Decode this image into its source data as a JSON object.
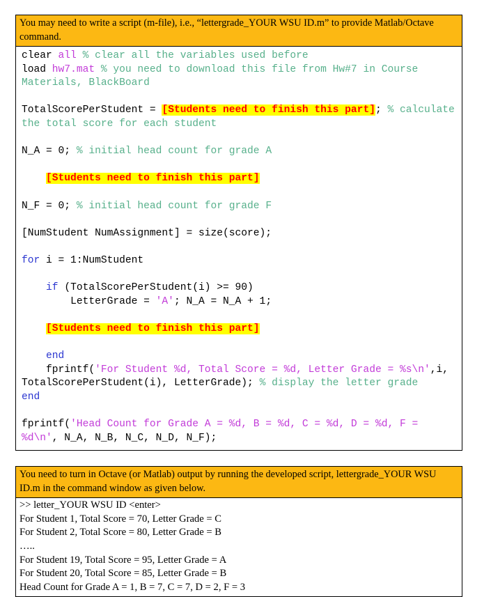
{
  "script_section": {
    "instruction": "You may need to write a script (m-file), i.e., “lettergrade_YOUR WSU ID.m” to provide Matlab/Octave command.",
    "code_lines": [
      [
        {
          "t": "clear ",
          "c": "plain"
        },
        {
          "t": "all ",
          "c": "str"
        },
        {
          "t": "% clear all the variables used before",
          "c": "cmt"
        }
      ],
      [
        {
          "t": "load ",
          "c": "plain"
        },
        {
          "t": "hw7.mat ",
          "c": "str"
        },
        {
          "t": "% you need to download this file from Hw#7 in Course Materials, BlackBoard",
          "c": "cmt"
        }
      ],
      [],
      [
        {
          "t": "TotalScorePerStudent = ",
          "c": "plain"
        },
        {
          "t": "[Students need to finish this part]",
          "c": "hl"
        },
        {
          "t": "; ",
          "c": "plain"
        },
        {
          "t": "% calculate the total score for each student",
          "c": "cmt"
        }
      ],
      [],
      [
        {
          "t": "N_A = 0; ",
          "c": "plain"
        },
        {
          "t": "% initial head count for grade A",
          "c": "cmt"
        }
      ],
      [],
      [
        {
          "t": "    ",
          "c": "plain"
        },
        {
          "t": "[Students need to finish this part]",
          "c": "hl"
        }
      ],
      [],
      [
        {
          "t": "N_F = 0; ",
          "c": "plain"
        },
        {
          "t": "% initial head count for grade F",
          "c": "cmt"
        }
      ],
      [],
      [
        {
          "t": "[NumStudent NumAssignment] = size(score);",
          "c": "plain"
        }
      ],
      [],
      [
        {
          "t": "for ",
          "c": "kw"
        },
        {
          "t": "i = 1:NumStudent",
          "c": "plain"
        }
      ],
      [],
      [
        {
          "t": "    ",
          "c": "plain"
        },
        {
          "t": "if ",
          "c": "kw"
        },
        {
          "t": "(TotalScorePerStudent(i) >= 90)",
          "c": "plain"
        }
      ],
      [
        {
          "t": "        LetterGrade = ",
          "c": "plain"
        },
        {
          "t": "'A'",
          "c": "str"
        },
        {
          "t": "; N_A = N_A + 1;",
          "c": "plain"
        }
      ],
      [],
      [
        {
          "t": "    ",
          "c": "plain"
        },
        {
          "t": "[Students need to finish this part]",
          "c": "hl"
        }
      ],
      [],
      [
        {
          "t": "    ",
          "c": "plain"
        },
        {
          "t": "end",
          "c": "kw"
        }
      ],
      [
        {
          "t": "    fprintf(",
          "c": "plain"
        },
        {
          "t": "'For Student %d, Total Score = %d, Letter Grade = %s\\n'",
          "c": "str"
        },
        {
          "t": ",i, TotalScorePerStudent(i), LetterGrade); ",
          "c": "plain"
        },
        {
          "t": "% display the letter grade",
          "c": "cmt"
        }
      ],
      [
        {
          "t": "end",
          "c": "kw"
        }
      ],
      [],
      [
        {
          "t": "fprintf(",
          "c": "plain"
        },
        {
          "t": "'Head Count for Grade A = %d, B = %d, C = %d, D = %d, F = %d\\n'",
          "c": "str"
        },
        {
          "t": ", N_A, N_B, N_C, N_D, N_F);",
          "c": "plain"
        }
      ]
    ]
  },
  "output_section": {
    "instruction": "You need to turn in Octave (or Matlab) output by running the developed script, lettergrade_YOUR WSU ID.m in the command window as given below.",
    "lines": [
      ">> letter_YOUR WSU ID <enter>",
      "For Student 1, Total Score = 70, Letter Grade = C",
      "For Student 2, Total Score = 80, Letter Grade = B",
      "…..",
      "For Student 19, Total Score = 95, Letter Grade = A",
      "For Student 20, Total Score = 85, Letter Grade = B",
      "Head Count for Grade A = 1, B = 7, C = 7, D = 2, F = 3"
    ]
  },
  "colors": {
    "callout_background": "#FCB813",
    "keyword": "#2B36D0",
    "string": "#C23BD8",
    "comment": "#57B08B",
    "highlight_background": "#FFFF00",
    "highlight_text": "#FF0000",
    "border": "#000000"
  }
}
